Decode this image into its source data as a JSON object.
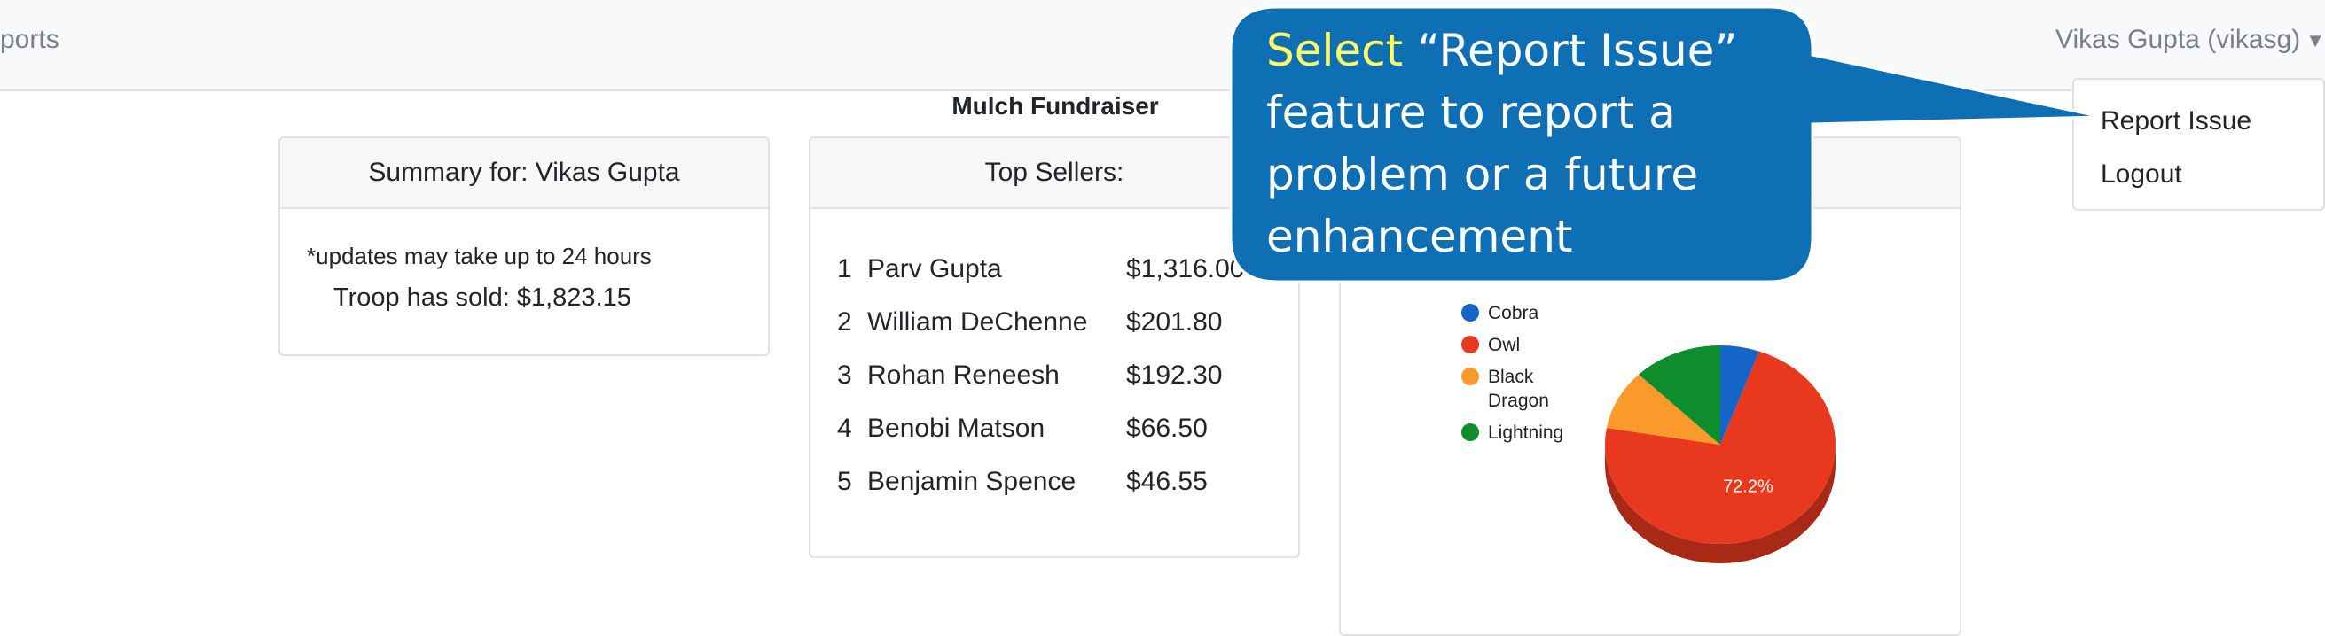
{
  "navbar": {
    "left_text": "ports",
    "user_label": "Vikas Gupta (vikasg)"
  },
  "page": {
    "title": "Mulch Fundraiser"
  },
  "summary": {
    "header": "Summary for: Vikas Gupta",
    "note": "*updates may take up to 24 hours",
    "sold": "Troop has sold: $1,823.15"
  },
  "top_sellers": {
    "header": "Top Sellers:",
    "rows": [
      {
        "rank": "1",
        "name": "Parv Gupta",
        "amount": "$1,316.00"
      },
      {
        "rank": "2",
        "name": "William DeChenne",
        "amount": "$201.80"
      },
      {
        "rank": "3",
        "name": "Rohan Reneesh",
        "amount": "$192.30"
      },
      {
        "rank": "4",
        "name": "Benobi Matson",
        "amount": "$66.50"
      },
      {
        "rank": "5",
        "name": "Benjamin Spence",
        "amount": "$46.55"
      }
    ]
  },
  "dropdown": {
    "items": [
      "Report Issue",
      "Logout"
    ]
  },
  "callout": {
    "highlight": "Select",
    "text": " “Report Issue” feature to report a problem or a future enhancement",
    "fill_color": "#0F6FB4",
    "highlight_color": "#FFFF66"
  },
  "chart_data": {
    "type": "pie",
    "series": [
      {
        "label": "Cobra",
        "value": 5.5,
        "color": "#1565C8"
      },
      {
        "label": "Owl",
        "value": 72.2,
        "color": "#E8391E"
      },
      {
        "label": "Black Dragon",
        "value": 9.8,
        "color": "#F99A2B"
      },
      {
        "label": "Lightning",
        "value": 12.5,
        "color": "#0E8D2D"
      }
    ],
    "data_labels": [
      "",
      "72.2%",
      "",
      ""
    ],
    "legend_position": "left"
  }
}
